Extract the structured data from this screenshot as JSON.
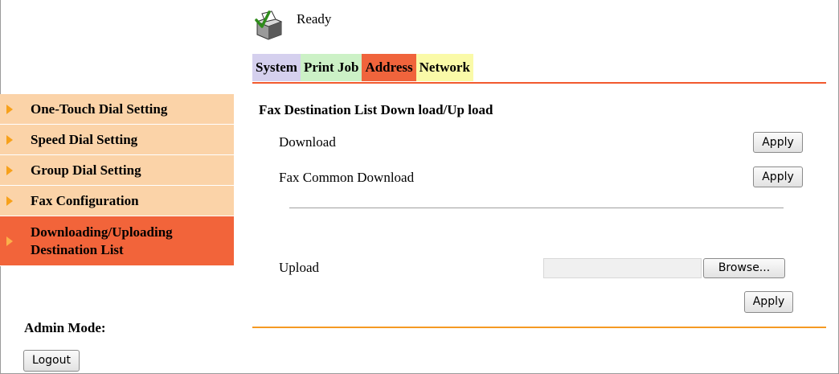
{
  "status": {
    "icon": "printer-icon",
    "text": "Ready"
  },
  "tabs": [
    {
      "label": "System",
      "color": "#d5d0ee"
    },
    {
      "label": "Print Job",
      "color": "#ccf1c6"
    },
    {
      "label": "Address",
      "color": "#f0643c",
      "active": true
    },
    {
      "label": "Network",
      "color": "#fafaa8"
    }
  ],
  "sidebar": {
    "items": [
      {
        "label": "One-Touch Dial Setting"
      },
      {
        "label": "Speed Dial Setting"
      },
      {
        "label": "Group Dial Setting"
      },
      {
        "label": "Fax Configuration"
      },
      {
        "label_line1": "Downloading/Uploading",
        "label_line2": "Destination List",
        "active": true
      }
    ],
    "admin_label": "Admin Mode:",
    "logout_label": "Logout"
  },
  "main": {
    "title": "Fax Destination List Down load/Up load",
    "download_label": "Download",
    "download_apply": "Apply",
    "common_label": "Fax Common Download",
    "common_apply": "Apply",
    "upload_label": "Upload",
    "upload_value": "",
    "browse_label": "Browse...",
    "upload_apply": "Apply"
  },
  "colors": {
    "tab_underline": "#f25a2e",
    "sidebar_item": "#fbd3a8",
    "sidebar_active": "#f2643a",
    "bottom_line": "#f59a23",
    "arrow": "#f7a11a"
  }
}
